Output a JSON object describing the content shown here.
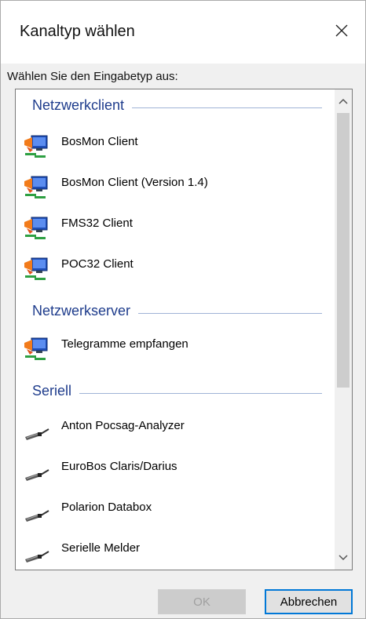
{
  "window": {
    "title": "Kanaltyp wählen",
    "close_icon": "close-icon"
  },
  "prompt": "Wählen Sie den Eingabetyp aus:",
  "groups": [
    {
      "title": "Netzwerkclient",
      "items": [
        {
          "label": "BosMon Client",
          "icon": "network-computer-icon"
        },
        {
          "label": "BosMon Client (Version 1.4)",
          "icon": "network-computer-icon"
        },
        {
          "label": "FMS32 Client",
          "icon": "network-computer-icon"
        },
        {
          "label": "POC32 Client",
          "icon": "network-computer-icon"
        }
      ]
    },
    {
      "title": "Netzwerkserver",
      "items": [
        {
          "label": "Telegramme empfangen",
          "icon": "network-computer-icon"
        }
      ]
    },
    {
      "title": "Seriell",
      "items": [
        {
          "label": "Anton Pocsag-Analyzer",
          "icon": "serial-cable-icon"
        },
        {
          "label": "EuroBos Claris/Darius",
          "icon": "serial-cable-icon"
        },
        {
          "label": "Polarion Databox",
          "icon": "serial-cable-icon"
        },
        {
          "label": "Serielle Melder",
          "icon": "serial-cable-icon"
        }
      ]
    }
  ],
  "buttons": {
    "ok": "OK",
    "cancel": "Abbrechen",
    "ok_enabled": false
  },
  "colors": {
    "group_title": "#1e3c8c",
    "default_button_border": "#0078d7"
  }
}
